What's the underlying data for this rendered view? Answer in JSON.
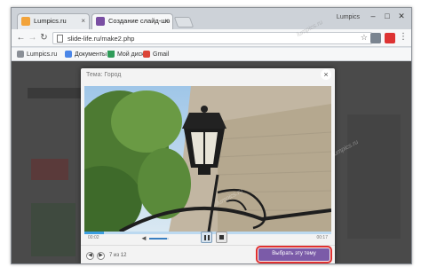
{
  "browser": {
    "tabs": [
      {
        "label": "Lumpics.ru"
      },
      {
        "label": "Создание слайд-шо"
      }
    ],
    "user_name": "Lumpics",
    "window_controls": {
      "minimize": "–",
      "maximize": "□",
      "close": "✕"
    },
    "url": "slide-life.ru/make2.php",
    "bookmarks": [
      {
        "label": "Lumpics.ru"
      },
      {
        "label": "Документы"
      },
      {
        "label": "Мой диск"
      },
      {
        "label": "Gmail"
      }
    ]
  },
  "modal": {
    "title": "Тема: Город",
    "close_glyph": "×",
    "player": {
      "time_current": "00:02",
      "time_total": "00:17",
      "progress_fraction": 0.08,
      "volume_fraction": 0.9
    },
    "counter": "7 из 12",
    "prev_glyph": "◀",
    "next_glyph": "▶",
    "choose_button": "Выбрать эту тему"
  },
  "watermark": "lumpics.ru",
  "colors": {
    "accent": "#7b5ba8",
    "highlight": "#e03030",
    "progress": "#3a9ee0"
  }
}
